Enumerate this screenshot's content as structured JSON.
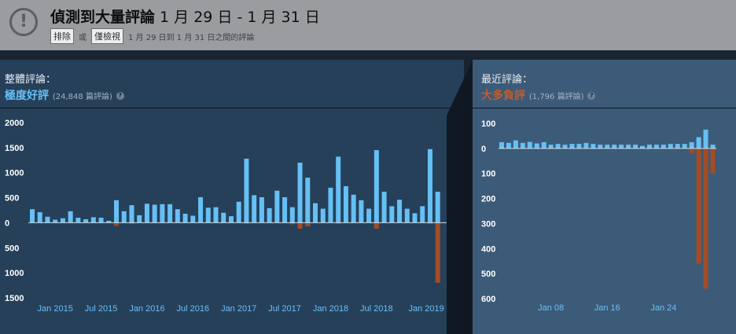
{
  "banner": {
    "title_bold": "偵測到大量評論",
    "title_dates": " 1 月 29 日 - 1 月 31 日",
    "exclude_label": "排除",
    "or_label": "或",
    "only_view_label": "僅檢視",
    "range_text": "1 月 29 日到 1 月 31 日之間的評論"
  },
  "overall": {
    "heading": "整體評論：",
    "score": "極度好評",
    "count": "(24,848 篇評論)",
    "score_color": "#66c0f4"
  },
  "recent": {
    "heading": "最近評論：",
    "score": "大多負評",
    "count": "(1,796 篇評論)",
    "score_color": "#c35c2c"
  },
  "chart_data": [
    {
      "type": "bar",
      "ylim": [
        -1500,
        2000
      ],
      "ytick_labels": [
        "2000",
        "1500",
        "1000",
        "500",
        "0",
        "500",
        "1000",
        "1500"
      ],
      "ytick_values": [
        2000,
        1500,
        1000,
        500,
        0,
        -500,
        -1000,
        -1500
      ],
      "xtick_labels": [
        "Jan 2015",
        "Jul 2015",
        "Jan 2016",
        "Jul 2016",
        "Jan 2017",
        "Jul 2017",
        "Jan 2018",
        "Jul 2018",
        "Jan 2019"
      ],
      "xtick_index": [
        3,
        9,
        15,
        21,
        27,
        33,
        39,
        45,
        51.5
      ],
      "positive_color": "#66c0f4",
      "negative_color": "#a34c25",
      "positive": [
        270,
        210,
        120,
        60,
        90,
        230,
        100,
        70,
        110,
        100,
        40,
        450,
        230,
        350,
        150,
        380,
        360,
        370,
        370,
        270,
        180,
        140,
        510,
        300,
        310,
        200,
        130,
        420,
        1280,
        550,
        510,
        290,
        640,
        510,
        310,
        1200,
        900,
        390,
        280,
        700,
        1320,
        730,
        560,
        450,
        280,
        1450,
        620,
        330,
        460,
        280,
        190,
        330,
        1470,
        620
      ],
      "negative": [
        0,
        0,
        0,
        0,
        0,
        0,
        0,
        0,
        0,
        0,
        0,
        -60,
        0,
        -20,
        0,
        0,
        -10,
        0,
        0,
        0,
        0,
        0,
        0,
        0,
        0,
        0,
        0,
        0,
        -20,
        0,
        0,
        0,
        0,
        0,
        -30,
        -120,
        -70,
        0,
        0,
        0,
        -20,
        0,
        0,
        0,
        0,
        -120,
        0,
        0,
        0,
        0,
        0,
        0,
        -20,
        -1200
      ]
    },
    {
      "type": "bar",
      "ylim": [
        -600,
        100
      ],
      "ytick_labels": [
        "100",
        "0",
        "100",
        "200",
        "300",
        "400",
        "500",
        "600"
      ],
      "ytick_values": [
        100,
        0,
        -100,
        -200,
        -300,
        -400,
        -500,
        -600
      ],
      "xtick_labels": [
        "Jan 08",
        "Jan 16",
        "Jan 24"
      ],
      "xtick_index": [
        7,
        15,
        23
      ],
      "positive_color": "#66c0f4",
      "negative_color": "#a34c25",
      "positive": [
        25,
        22,
        32,
        22,
        26,
        20,
        25,
        15,
        18,
        15,
        18,
        18,
        22,
        18,
        15,
        15,
        15,
        15,
        15,
        15,
        10,
        15,
        15,
        15,
        18,
        18,
        18,
        25,
        45,
        75,
        15
      ],
      "negative": [
        0,
        0,
        0,
        0,
        0,
        0,
        0,
        0,
        0,
        0,
        0,
        0,
        0,
        0,
        0,
        0,
        0,
        0,
        0,
        0,
        0,
        0,
        0,
        0,
        0,
        0,
        0,
        -20,
        -460,
        -560,
        -100
      ]
    }
  ]
}
